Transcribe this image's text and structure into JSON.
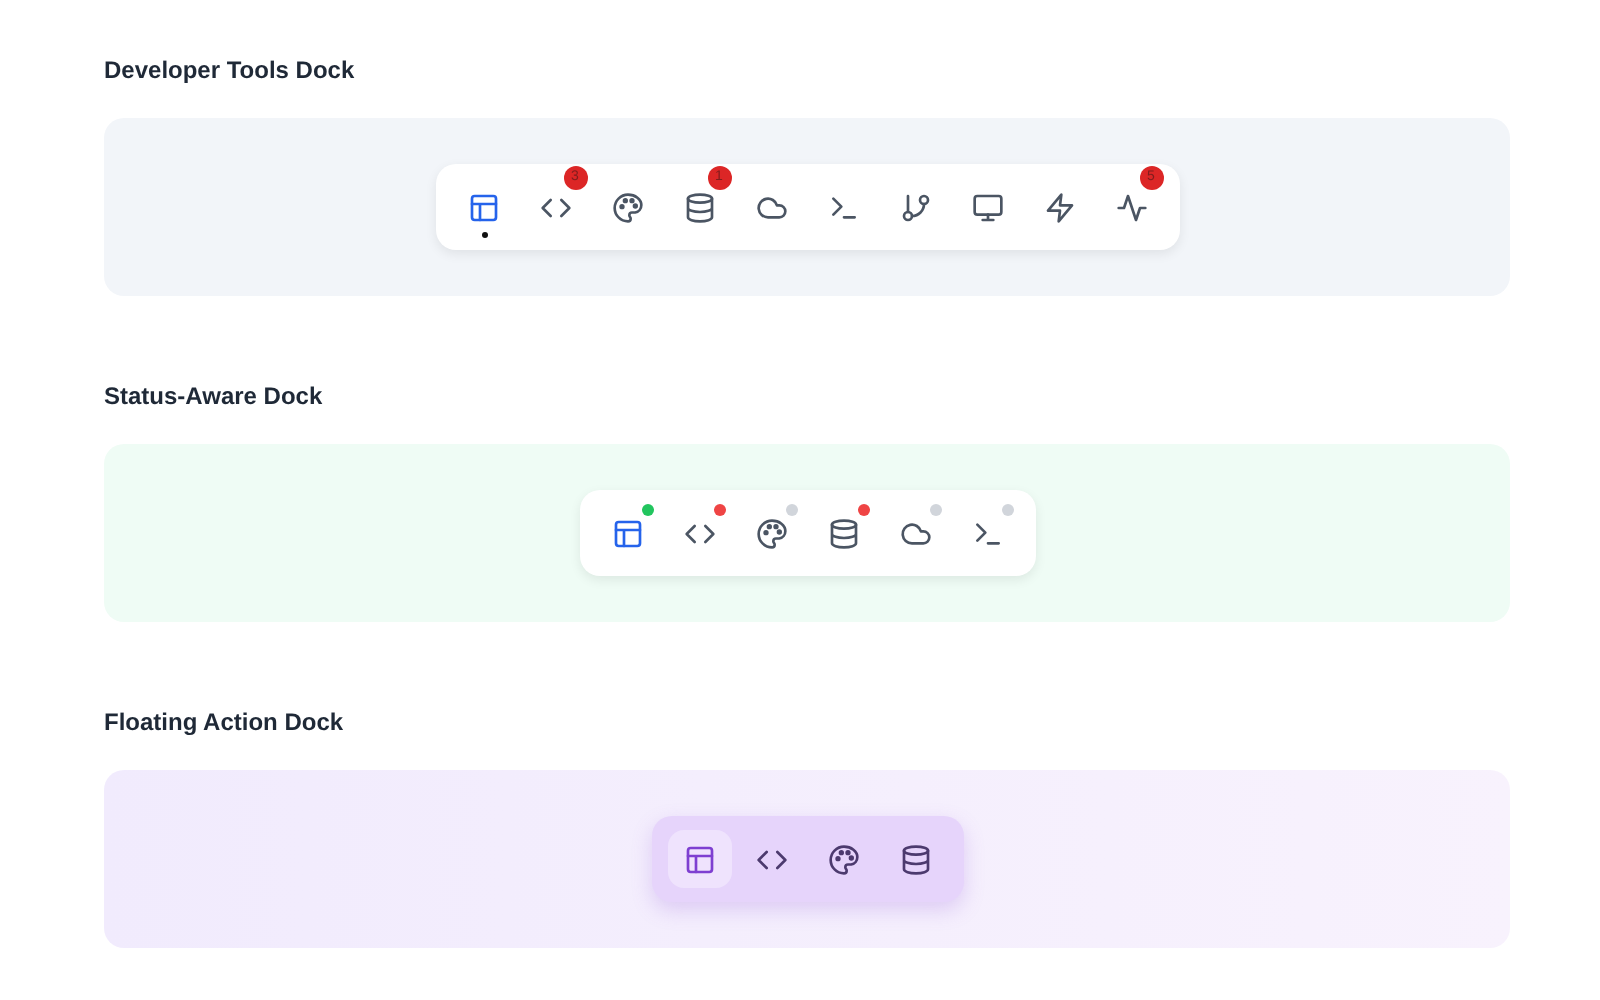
{
  "docks": [
    {
      "title": "Developer Tools Dock",
      "items": [
        {
          "selected": true
        },
        {
          "selected": false,
          "badge": "3"
        },
        {
          "selected": false
        },
        {
          "selected": false,
          "badge": "1"
        },
        {
          "selected": false
        },
        {
          "selected": false
        },
        {
          "selected": false
        },
        {
          "selected": false
        },
        {
          "selected": false
        },
        {
          "selected": false,
          "badge": "5"
        }
      ]
    },
    {
      "title": "Status-Aware Dock",
      "items": [
        {
          "selected": true,
          "color": "#22c55e"
        },
        {
          "selected": false,
          "color": "#ef4444"
        },
        {
          "selected": false,
          "color": "#d1d5db"
        },
        {
          "selected": false,
          "color": "#ef4444"
        },
        {
          "selected": false,
          "color": "#d1d5db"
        },
        {
          "selected": false,
          "color": "#d1d5db"
        }
      ]
    },
    {
      "title": "Floating Action Dock",
      "items": [
        {
          "selected": true
        },
        {
          "selected": false
        },
        {
          "selected": false
        },
        {
          "selected": false
        }
      ]
    }
  ]
}
